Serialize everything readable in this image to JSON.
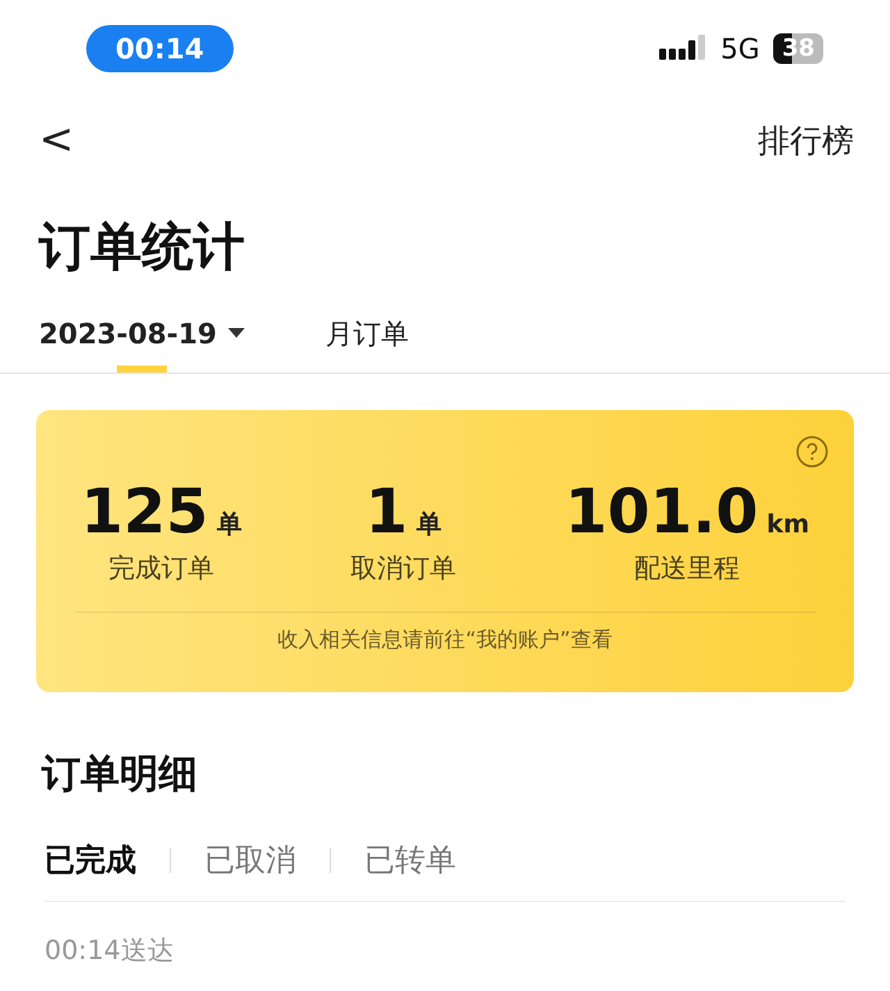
{
  "status_bar": {
    "time": "00:14",
    "network": "5G",
    "battery": "38"
  },
  "nav": {
    "back": "<",
    "action": "排行榜"
  },
  "title": "订单统计",
  "tabs": [
    {
      "label": "2023-08-19",
      "kind": "dropdown",
      "selected": true
    },
    {
      "label": "月订单",
      "kind": "plain",
      "selected": false
    }
  ],
  "summary": {
    "stats": [
      {
        "value": "125",
        "unit": "单",
        "label": "完成订单"
      },
      {
        "value": "1",
        "unit": "单",
        "label": "取消订单"
      },
      {
        "value": "101.0",
        "unit": "km",
        "label": "配送里程"
      }
    ],
    "note": "收入相关信息请前往“我的账户”查看"
  },
  "details": {
    "title": "订单明细",
    "tabs": [
      {
        "label": "已完成",
        "selected": true
      },
      {
        "label": "已取消",
        "selected": false
      },
      {
        "label": "已转单",
        "selected": false
      }
    ],
    "rows": [
      {
        "time": "00:14送达"
      }
    ]
  }
}
